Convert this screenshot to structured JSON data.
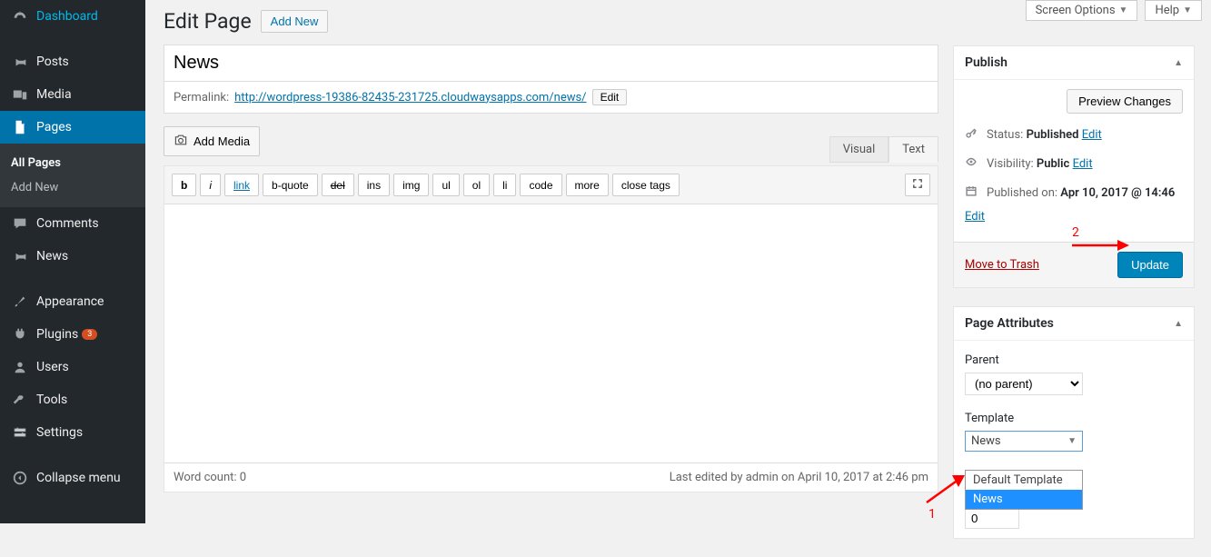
{
  "topbar": {
    "screen_options": "Screen Options",
    "help": "Help"
  },
  "sidebar": {
    "items": [
      {
        "label": "Dashboard"
      },
      {
        "label": "Posts"
      },
      {
        "label": "Media"
      },
      {
        "label": "Pages"
      },
      {
        "label": "Comments"
      },
      {
        "label": "News"
      },
      {
        "label": "Appearance"
      },
      {
        "label": "Plugins"
      },
      {
        "label": "Users"
      },
      {
        "label": "Tools"
      },
      {
        "label": "Settings"
      },
      {
        "label": "Collapse menu"
      }
    ],
    "plugins_badge": "3",
    "submenu": {
      "all": "All Pages",
      "add": "Add New"
    }
  },
  "header": {
    "title": "Edit Page",
    "add_new": "Add New"
  },
  "editor": {
    "title_value": "News",
    "permalink_label": "Permalink:",
    "permalink_url": "http://wordpress-19386-82435-231725.cloudwaysapps.com/news/",
    "permalink_edit": "Edit",
    "add_media": "Add Media",
    "tabs": {
      "visual": "Visual",
      "text": "Text"
    },
    "qt": [
      "b",
      "i",
      "link",
      "b-quote",
      "del",
      "ins",
      "img",
      "ul",
      "ol",
      "li",
      "code",
      "more",
      "close tags"
    ],
    "word_count_label": "Word count: ",
    "word_count": "0",
    "last_edited": "Last edited by admin on April 10, 2017 at 2:46 pm"
  },
  "publish": {
    "title": "Publish",
    "preview": "Preview Changes",
    "status_label": "Status:",
    "status": "Published",
    "visibility_label": "Visibility:",
    "visibility": "Public",
    "published_label": "Published on:",
    "published": "Apr 10, 2017 @ 14:46",
    "edit": "Edit",
    "trash": "Move to Trash",
    "update": "Update"
  },
  "attributes": {
    "title": "Page Attributes",
    "parent_label": "Parent",
    "parent_value": "(no parent)",
    "template_label": "Template",
    "template_value": "News",
    "options": [
      "Default Template",
      "News"
    ],
    "order_value": "0"
  },
  "annotations": {
    "n1": "1",
    "n2": "2"
  }
}
